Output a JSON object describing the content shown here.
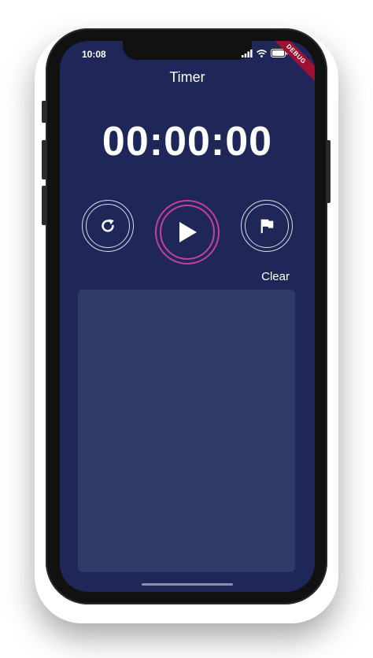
{
  "status_bar": {
    "time": "10:08",
    "icons": [
      "signal-icon",
      "wifi-icon",
      "battery-icon"
    ]
  },
  "debug_banner": {
    "label": "DEBUG",
    "color": "#9e1133"
  },
  "app_bar": {
    "title": "Timer"
  },
  "timer": {
    "display": "00:00:00"
  },
  "controls": {
    "reset": {
      "icon": "refresh-icon"
    },
    "play": {
      "icon": "play-icon",
      "accent": "#c43ea6"
    },
    "lap": {
      "icon": "flag-icon"
    }
  },
  "laps": {
    "clear_label": "Clear",
    "items": []
  },
  "colors": {
    "background": "#1e2757",
    "panel": "#303c68",
    "accent": "#c43ea6",
    "text": "#ffffff"
  }
}
